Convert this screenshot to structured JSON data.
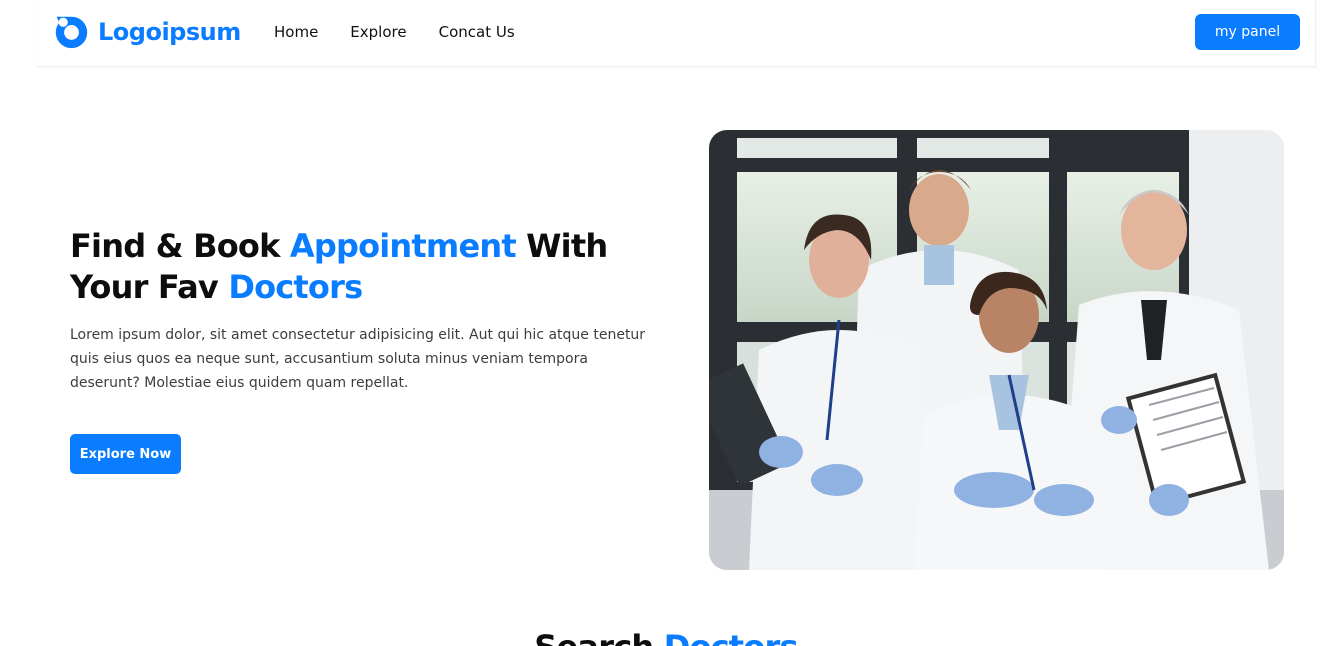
{
  "brand": {
    "name": "Logoipsum",
    "color": "#0a7cff",
    "icon": "logo-ring-icon"
  },
  "nav": {
    "links": [
      "Home",
      "Explore",
      "Concat Us"
    ],
    "panel_button": "my panel"
  },
  "hero": {
    "title_part1": "Find & Book ",
    "title_accent1": "Appointment",
    "title_part2": " With Your Fav ",
    "title_accent2": "Doctors",
    "description": "Lorem ipsum dolor, sit amet consectetur adipisicing elit. Aut qui hic atque tenetur quis eius quos ea neque sunt, accusantium soluta minus veniam tempora deserunt? Molestiae eius quidem quam repellat.",
    "cta": "Explore Now",
    "image": "team-of-doctors-photo"
  },
  "next_section": {
    "heading_part1": "Search ",
    "heading_accent": "Doctors"
  }
}
